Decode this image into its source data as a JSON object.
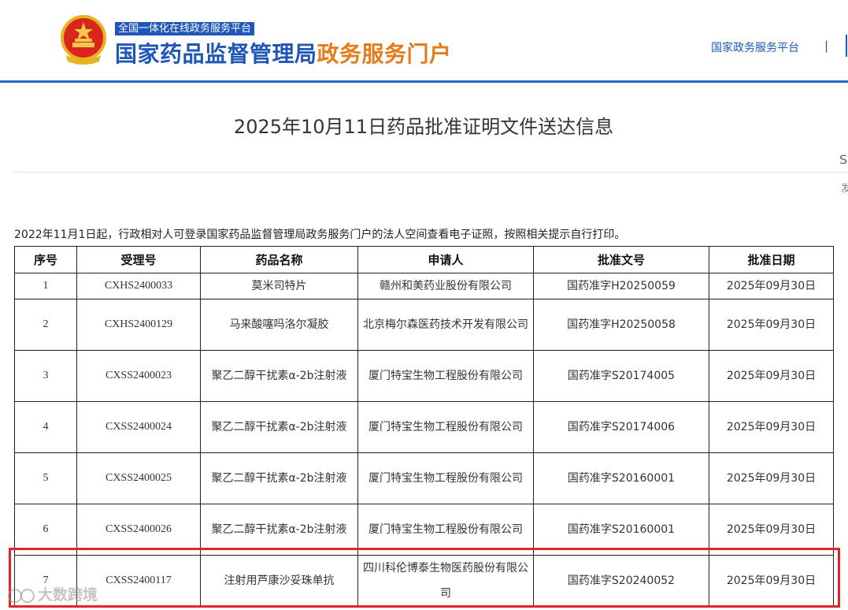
{
  "header": {
    "tagline": "全国一体化在线政务服务平台",
    "brand_main": "国家药品监督管理局",
    "brand_sub": "政务服务门户",
    "top_link": "国家政务服务平台",
    "top_sep": "|",
    "colors": {
      "primary": "#1f56b8",
      "accent": "#e57b19"
    }
  },
  "page": {
    "title": "2025年10月11日药品批准证明文件送达信息",
    "side_frag1": "S",
    "side_frag2": "发",
    "notice": "2022年11月1日起，行政相对人可登录国家药品监督管理局政务服务门户的法人空间查看电子证照，按照相关提示自行打印。"
  },
  "table": {
    "headers": [
      "序号",
      "受理号",
      "药品名称",
      "申请人",
      "批准文号",
      "批准日期"
    ],
    "rows": [
      [
        "1",
        "CXHS2400033",
        "莫米司特片",
        "赣州和美药业股份有限公司",
        "国药准字H20250059",
        "2025年09月30日"
      ],
      [
        "2",
        "CXHS2400129",
        "马来酸噻吗洛尔凝胶",
        "北京梅尔森医药技术开发有限公司",
        "国药准字H20250058",
        "2025年09月30日"
      ],
      [
        "3",
        "CXSS2400023",
        "聚乙二醇干扰素α-2b注射液",
        "厦门特宝生物工程股份有限公司",
        "国药准字S20174005",
        "2025年09月30日"
      ],
      [
        "4",
        "CXSS2400024",
        "聚乙二醇干扰素α-2b注射液",
        "厦门特宝生物工程股份有限公司",
        "国药准字S20174006",
        "2025年09月30日"
      ],
      [
        "5",
        "CXSS2400025",
        "聚乙二醇干扰素α-2b注射液",
        "厦门特宝生物工程股份有限公司",
        "国药准字S20160001",
        "2025年09月30日"
      ],
      [
        "6",
        "CXSS2400026",
        "聚乙二醇干扰素α-2b注射液",
        "厦门特宝生物工程股份有限公司",
        "国药准字S20160001",
        "2025年09月30日"
      ],
      [
        "7",
        "CXSS2400117",
        "注射用芦康沙妥珠单抗",
        "四川科伦博泰生物医药股份有限公司",
        "国药准字S20240052",
        "2025年09月30日"
      ]
    ],
    "highlighted_row": 7,
    "highlight_color": "#e0242b"
  },
  "watermark": "大数跨境"
}
